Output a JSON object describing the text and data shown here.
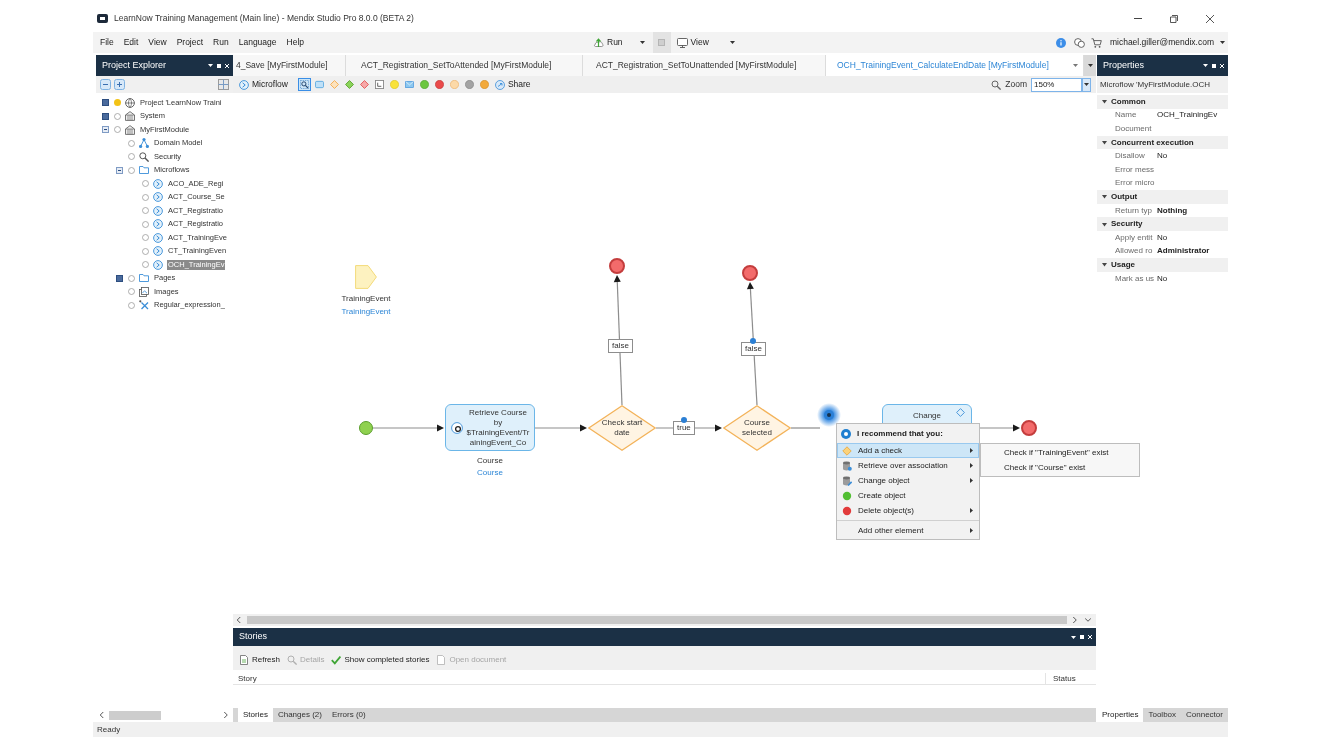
{
  "window": {
    "title": "LearnNow Training Management (Main line) - Mendix Studio Pro 8.0.0 (BETA 2)"
  },
  "menu_bar": [
    "File",
    "Edit",
    "View",
    "Project",
    "Run",
    "Language",
    "Help"
  ],
  "toolbar": {
    "run": "Run",
    "view": "View",
    "account": "michael.giller@mendix.com"
  },
  "project_explorer": {
    "title": "Project Explorer",
    "tree": [
      {
        "label": "Project 'LearnNow Traini",
        "kind": "project",
        "expanded": false,
        "selected": false
      },
      {
        "label": "System",
        "kind": "module",
        "expanded": false,
        "selected": false
      },
      {
        "label": "MyFirstModule",
        "kind": "module",
        "expanded": true,
        "selected": false,
        "children": [
          {
            "label": "Domain Model",
            "kind": "domain-model",
            "selected": false
          },
          {
            "label": "Security",
            "kind": "security",
            "selected": false
          },
          {
            "label": "Microflows",
            "kind": "folder",
            "expanded": true,
            "selected": false,
            "children": [
              {
                "label": "ACO_ADE_Regi",
                "kind": "microflow",
                "selected": false
              },
              {
                "label": "ACT_Course_Se",
                "kind": "microflow",
                "selected": false
              },
              {
                "label": "ACT_Registratio",
                "kind": "microflow",
                "selected": false
              },
              {
                "label": "ACT_Registratio",
                "kind": "microflow",
                "selected": false
              },
              {
                "label": "ACT_TrainingEve",
                "kind": "microflow",
                "selected": false
              },
              {
                "label": "CT_TrainingEven",
                "kind": "microflow",
                "selected": false
              },
              {
                "label": "OCH_TrainingEv",
                "kind": "microflow",
                "selected": true
              }
            ]
          },
          {
            "label": "Pages",
            "kind": "folder",
            "expanded": false,
            "selected": false
          },
          {
            "label": "Images",
            "kind": "images",
            "selected": false
          },
          {
            "label": "Regular_expression_",
            "kind": "regex",
            "selected": false
          }
        ]
      }
    ]
  },
  "document_tabs": [
    {
      "label": "4_Save [MyFirstModule]",
      "selected": false
    },
    {
      "label": "ACT_Registration_SetToAttended [MyFirstModule]",
      "selected": false
    },
    {
      "label": "ACT_Registration_SetToUnattended [MyFirstModule]",
      "selected": false
    },
    {
      "label": "OCH_TrainingEvent_CalculateEndDate [MyFirstModule]",
      "selected": true
    }
  ],
  "microflow_toolbar": {
    "mode": "Microflow",
    "tools": [
      {
        "kind": "select",
        "selected": true
      },
      {
        "kind": "activity",
        "selected": false
      },
      {
        "kind": "decision",
        "selected": false
      },
      {
        "kind": "object-decision",
        "selected": false
      },
      {
        "kind": "merge",
        "selected": false
      },
      {
        "kind": "loop",
        "selected": false
      },
      {
        "kind": "annotation",
        "selected": false
      },
      {
        "kind": "message",
        "selected": false
      },
      {
        "kind": "start",
        "selected": false
      },
      {
        "kind": "end",
        "selected": false
      },
      {
        "kind": "error",
        "selected": false
      },
      {
        "kind": "continue",
        "selected": false
      },
      {
        "kind": "break",
        "selected": false
      }
    ],
    "share": "Share",
    "zoom_label": "Zoom",
    "zoom": "150%"
  },
  "microflow": {
    "parameter": {
      "name": "TrainingEvent",
      "type": "TrainingEvent"
    },
    "nodes": [
      {
        "kind": "start"
      },
      {
        "kind": "retrieve",
        "caption": "Retrieve Course by $TrainingEvent/TrainingEvent_Co",
        "output_name": "Course",
        "output_type": "Course"
      },
      {
        "kind": "decision",
        "caption": "Check start date"
      },
      {
        "kind": "end"
      },
      {
        "kind": "decision",
        "caption": "Course selected"
      },
      {
        "kind": "end"
      },
      {
        "kind": "change",
        "caption": "Change"
      },
      {
        "kind": "end"
      }
    ],
    "flows": [
      {
        "label": "false",
        "handle": false
      },
      {
        "label": "true",
        "handle": true
      },
      {
        "label": "false",
        "handle": true
      }
    ]
  },
  "context_menu": {
    "title": "I recommend that you:",
    "groups": [
      [
        {
          "label": "Add a check",
          "kind": "check",
          "selected": true,
          "has_submenu": true,
          "submenu_items": [
            "Check if \"TrainingEvent\" exist",
            "Check if \"Course\" exist"
          ]
        },
        {
          "label": "Retrieve over association",
          "kind": "retrieve",
          "selected": false,
          "has_submenu": true
        },
        {
          "label": "Change object",
          "kind": "change",
          "selected": false,
          "has_submenu": true
        },
        {
          "label": "Create object",
          "kind": "create",
          "selected": false,
          "has_submenu": false
        },
        {
          "label": "Delete object(s)",
          "kind": "delete",
          "selected": false,
          "has_submenu": true
        }
      ],
      [
        {
          "label": "Add other element",
          "kind": "other",
          "selected": false,
          "has_submenu": true
        }
      ]
    ]
  },
  "properties": {
    "title": "Properties",
    "subject": "Microflow 'MyFirstModule.OCH",
    "sections": [
      {
        "title": "Common",
        "expanded": true,
        "rows": [
          {
            "label": "Name",
            "value": "OCH_TrainingEv",
            "emphasized": false
          },
          {
            "label": "Document"
          }
        ]
      },
      {
        "title": "Concurrent execution",
        "expanded": true,
        "rows": [
          {
            "label": "Disallow",
            "value": "No",
            "emphasized": false
          },
          {
            "label": "Error mess"
          },
          {
            "label": "Error micro"
          }
        ]
      },
      {
        "title": "Output",
        "expanded": true,
        "rows": [
          {
            "label": "Return typ",
            "value": "Nothing",
            "emphasized": true
          }
        ]
      },
      {
        "title": "Security",
        "expanded": true,
        "rows": [
          {
            "label": "Apply entit",
            "value": "No",
            "emphasized": false
          },
          {
            "label": "Allowed ro",
            "value": "Administrator",
            "emphasized": true
          }
        ]
      },
      {
        "title": "Usage",
        "expanded": true,
        "rows": [
          {
            "label": "Mark as us",
            "value": "No",
            "emphasized": false
          }
        ]
      }
    ],
    "tabs": [
      {
        "label": "Properties",
        "selected": true
      },
      {
        "label": "Toolbox",
        "selected": false
      },
      {
        "label": "Connector",
        "selected": false
      }
    ]
  },
  "stories": {
    "title": "Stories",
    "toolbar": [
      {
        "kind": "button",
        "label": "Refresh",
        "disabled": false
      },
      {
        "kind": "button",
        "label": "Details",
        "disabled": true
      },
      {
        "kind": "toggle",
        "label": "Show completed stories",
        "checked": true
      },
      {
        "kind": "button",
        "label": "Open document",
        "disabled": true
      }
    ],
    "columns": [
      "Story",
      "Status"
    ],
    "tabs": [
      {
        "label": "Stories",
        "selected": true
      },
      {
        "label": "Changes (2)",
        "selected": false
      },
      {
        "label": "Errors (0)",
        "selected": false
      }
    ]
  },
  "status_bar": "Ready"
}
